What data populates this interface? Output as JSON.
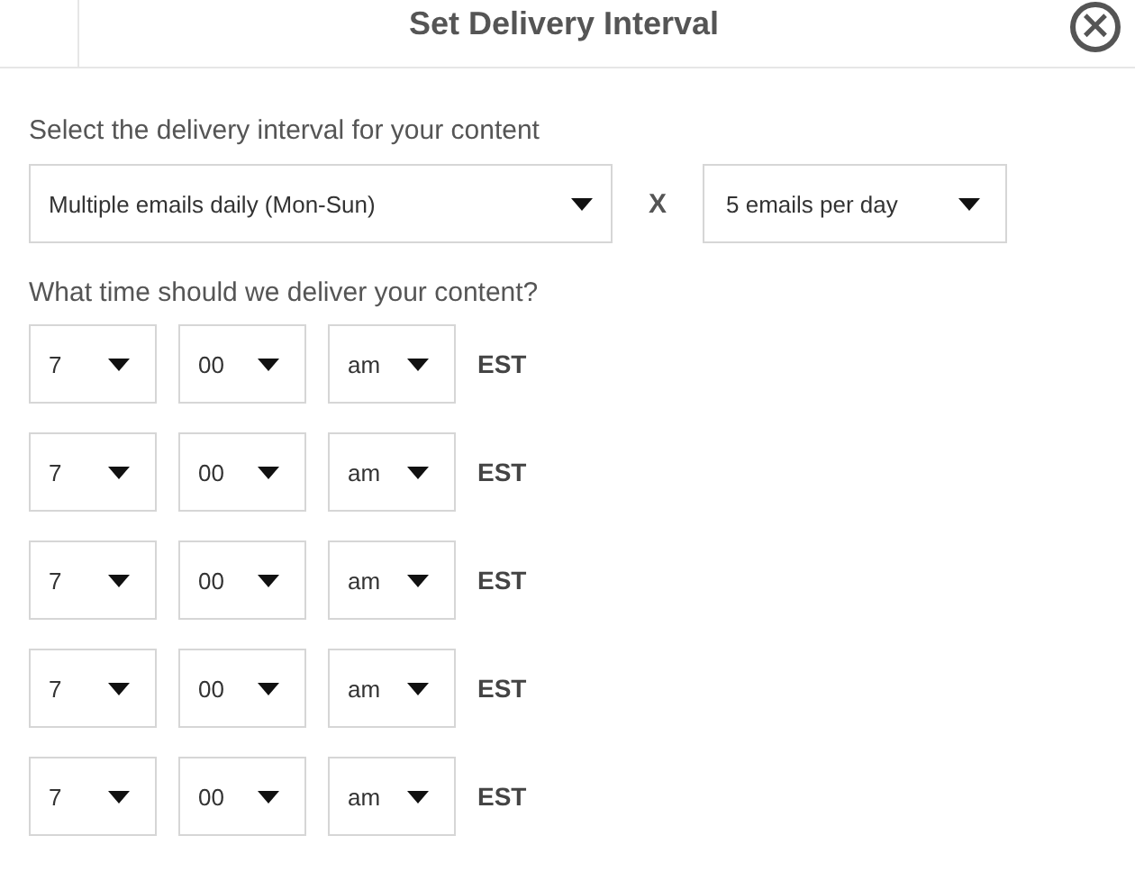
{
  "dialog": {
    "title": "Set Delivery Interval",
    "close_label": "×"
  },
  "interval": {
    "label": "Select the delivery interval for your content",
    "frequency": "Multiple emails daily (Mon-Sun)",
    "multiplier": "X",
    "count": "5 emails per day"
  },
  "times": {
    "label": "What time should we deliver your content?",
    "rows": [
      {
        "hour": "7",
        "minute": "00",
        "period": "am",
        "zone": "EST"
      },
      {
        "hour": "7",
        "minute": "00",
        "period": "am",
        "zone": "EST"
      },
      {
        "hour": "7",
        "minute": "00",
        "period": "am",
        "zone": "EST"
      },
      {
        "hour": "7",
        "minute": "00",
        "period": "am",
        "zone": "EST"
      },
      {
        "hour": "7",
        "minute": "00",
        "period": "am",
        "zone": "EST"
      }
    ]
  }
}
